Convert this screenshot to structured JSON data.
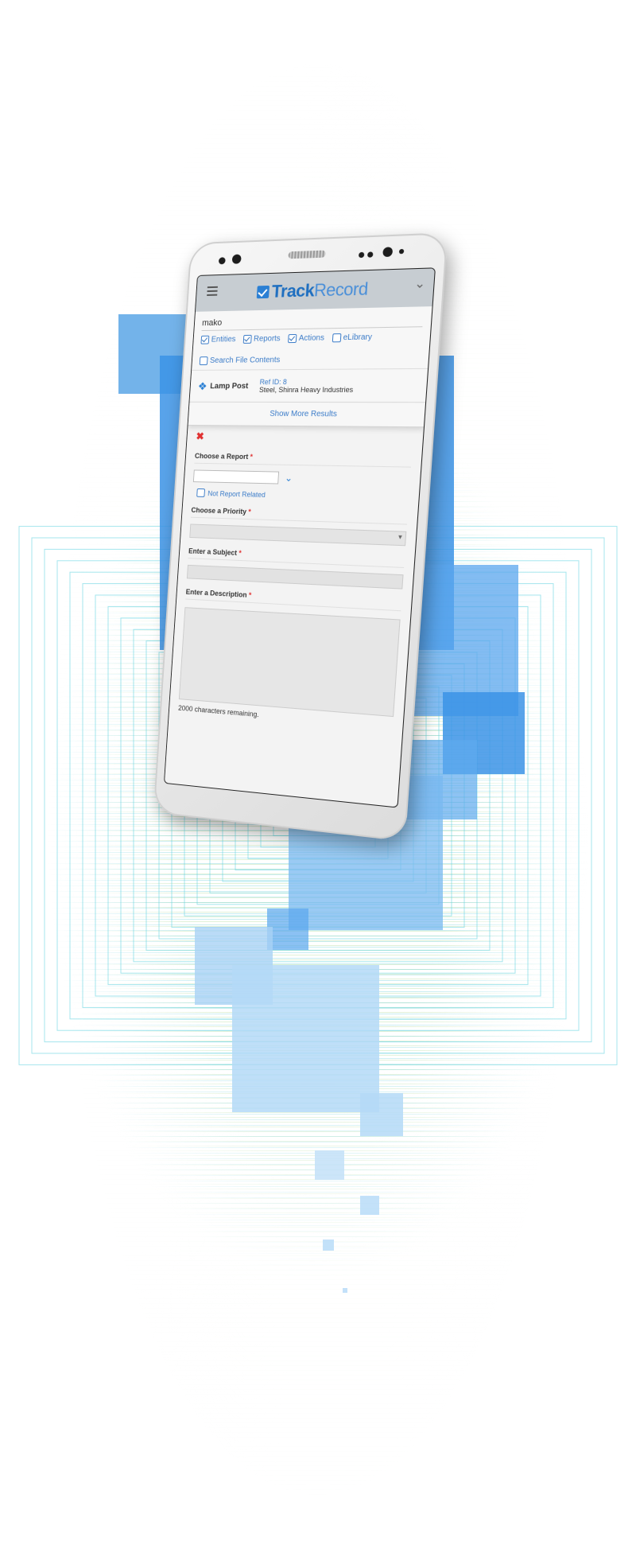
{
  "app": {
    "logo_track": "Track",
    "logo_record": "Record"
  },
  "search": {
    "query": "mako",
    "filters": [
      {
        "label": "Entities",
        "checked": true
      },
      {
        "label": "Reports",
        "checked": true
      },
      {
        "label": "Actions",
        "checked": true
      },
      {
        "label": "eLibrary",
        "checked": false
      }
    ],
    "file_contents": {
      "label": "Search File Contents",
      "checked": false
    }
  },
  "result": {
    "name": "Lamp Post",
    "ref": "Ref ID: 8",
    "subtitle": "Steel, Shinra Heavy Industries",
    "icon": "entity-icon"
  },
  "show_more": "Show More Results",
  "form": {
    "report_label": "Choose a Report",
    "not_related_label": "Not Report Related",
    "priority_label": "Choose a Priority",
    "subject_label": "Enter a Subject",
    "description_label": "Enter a Description",
    "required_mark": "*",
    "remaining": "2000 characters remaining."
  },
  "colors": {
    "brand_blue": "#2a7fd4",
    "link_blue": "#3a7bc8",
    "required_red": "#e03030"
  }
}
